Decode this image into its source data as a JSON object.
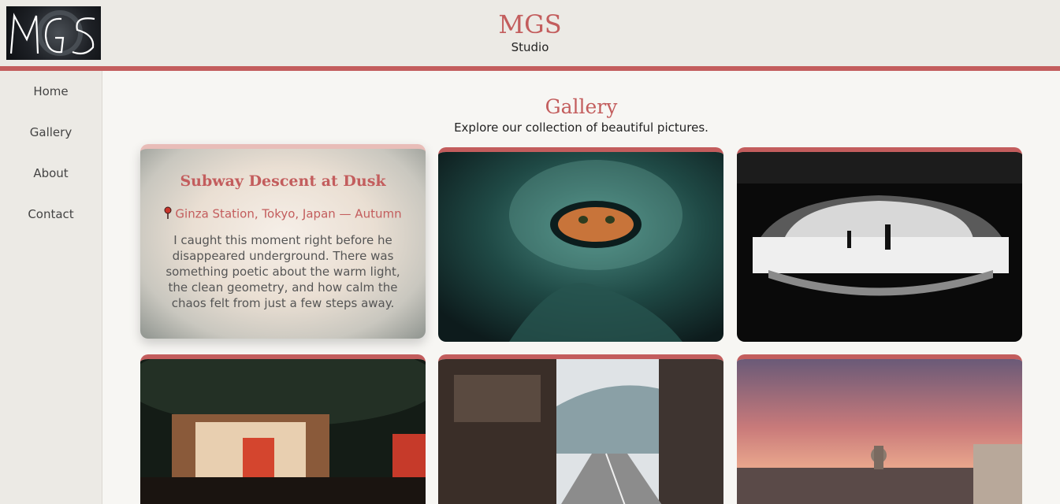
{
  "header": {
    "logo_text": "MGS",
    "title": "MGS",
    "subtitle": "Studio"
  },
  "sidebar": {
    "items": [
      {
        "label": "Home"
      },
      {
        "label": "Gallery"
      },
      {
        "label": "About"
      },
      {
        "label": "Contact"
      }
    ]
  },
  "main": {
    "title": "Gallery",
    "subtitle": "Explore our collection of beautiful pictures."
  },
  "featured_card": {
    "title": "Subway Descent at Dusk",
    "location": "Ginza Station, Tokyo, Japan — Autumn",
    "description": "I caught this moment right before he disappeared underground. There was something poetic about the warm light, the clean geometry, and how calm the chaos felt from just a few steps away.",
    "pin_icon": "location-pin-icon"
  },
  "colors": {
    "accent": "#c35d5d",
    "header_bg": "#eceae5",
    "page_bg": "#f7f6f3"
  }
}
